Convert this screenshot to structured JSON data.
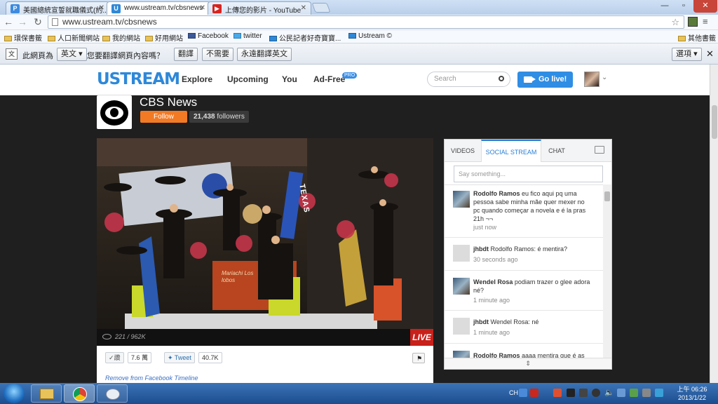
{
  "browser": {
    "tabs": [
      {
        "title": "美國總統宣誓就職儀式(約...",
        "favicon": "P"
      },
      {
        "title": "www.ustream.tv/cbsnews",
        "favicon": "U"
      },
      {
        "title": "上傳您的影片 - YouTube",
        "favicon": "▶"
      }
    ],
    "url": "www.ustream.tv/cbsnews",
    "bookmarks": [
      "環保書籤",
      "人口新聞網站",
      "我的網站",
      "好用網站",
      "Facebook",
      "twitter",
      "公民記者好奇寶寶...",
      "Ustream ©"
    ],
    "other_bookmarks": "其他書籤"
  },
  "translate_bar": {
    "prefix": "此網頁為",
    "language": "英文",
    "question": "您要翻譯網頁內容嗎？",
    "translate": "翻譯",
    "no": "不需要",
    "always": "永遠翻譯英文",
    "options": "選項"
  },
  "ustream": {
    "logo": "USTREAM",
    "nav": [
      "Explore",
      "Upcoming",
      "You",
      "Ad-Free"
    ],
    "pro_badge": "PRO",
    "search_placeholder": "Search",
    "go_live": "Go live!"
  },
  "channel": {
    "name": "CBS News",
    "follow": "Follow",
    "followers_count": "21,438",
    "followers_label": "followers"
  },
  "player": {
    "viewers": "221",
    "total": "962K",
    "live": "LIVE",
    "banner_text": "TEXAS",
    "banner_text2": "Mariachi Los lobos"
  },
  "share": {
    "like": "讚",
    "like_count": "7.6 萬",
    "tweet": "Tweet",
    "tweet_count": "40.7K",
    "remove_fb": "Remove from Facebook Timeline"
  },
  "panel": {
    "tabs": [
      "VIDEOS",
      "SOCIAL STREAM",
      "CHAT"
    ],
    "say_placeholder": "Say something...",
    "posts": [
      {
        "user": "Rodolfo Ramos",
        "text": "eu fico aqui pq uma pessoa sabe minha mãe quer mexer no pc quando começar a novela e é la pras 21h ¬¬",
        "time": "just now"
      },
      {
        "user": "jhbdt",
        "text": "Rodolfo Ramos: é mentira?",
        "time": "30 seconds ago"
      },
      {
        "user": "Wendel Rosa",
        "text": "podiam trazer o glee adora né?",
        "time": "1 minute ago"
      },
      {
        "user": "jhbdt",
        "text": "Wendel Rosa: né",
        "time": "1 minute ago"
      },
      {
        "user": "Rodolfo Ramos",
        "text": "aaaa mentira que é as",
        "time": ""
      }
    ]
  },
  "taskbar": {
    "lang": "CH",
    "time": "上午 06:26",
    "date": "2013/1/22"
  }
}
